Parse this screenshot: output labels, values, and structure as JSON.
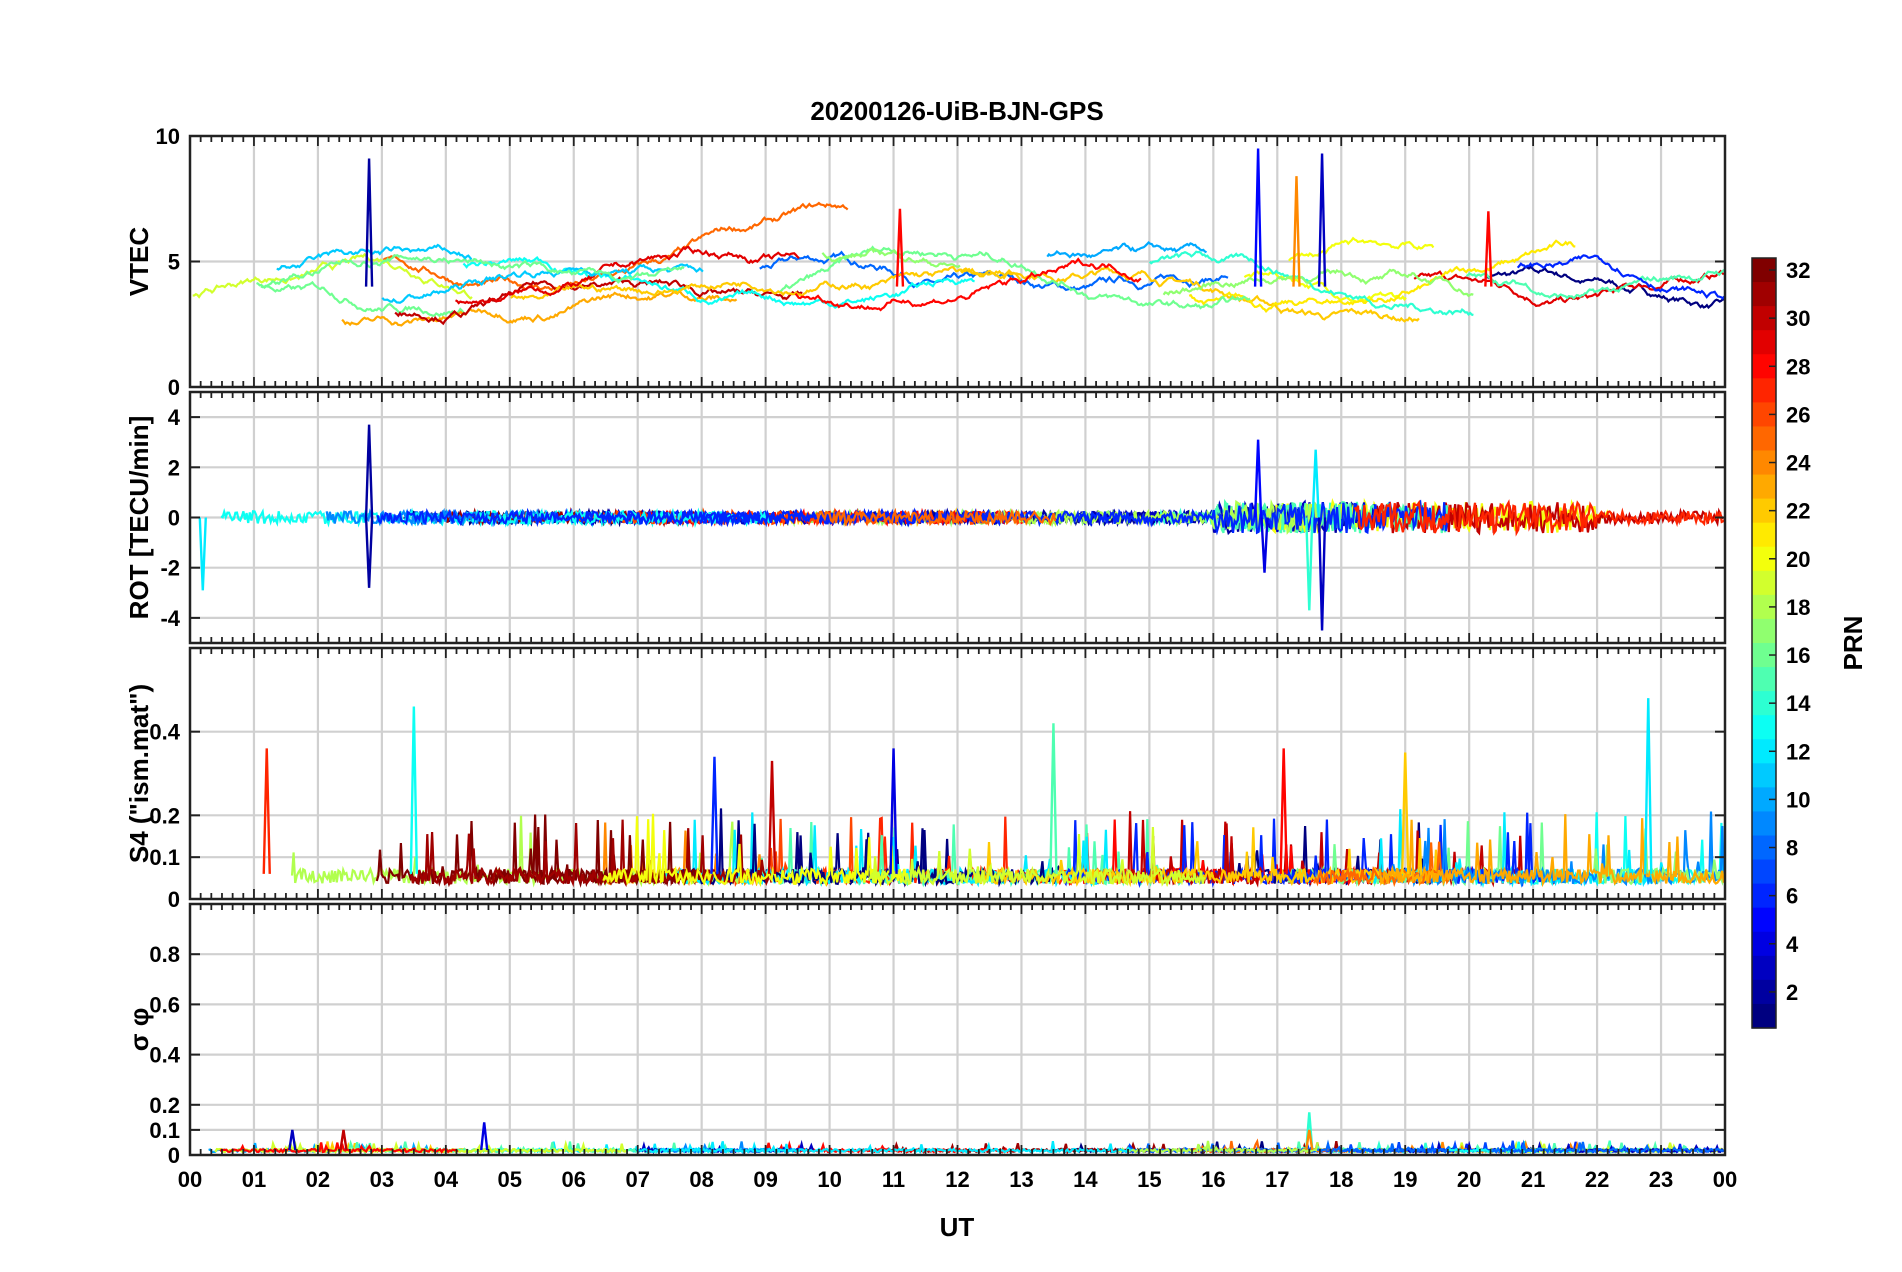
{
  "chart_data": {
    "type": "line",
    "title": "20200126-UiB-BJN-GPS",
    "xlabel": "UT",
    "x_ticks": [
      "00",
      "01",
      "02",
      "03",
      "04",
      "05",
      "06",
      "07",
      "08",
      "09",
      "10",
      "11",
      "12",
      "13",
      "14",
      "15",
      "16",
      "17",
      "18",
      "19",
      "20",
      "21",
      "22",
      "23",
      "00"
    ],
    "xlim_hours": [
      0,
      24
    ],
    "grid": true,
    "colormap": "jet",
    "colorbar": {
      "label": "PRN",
      "range": [
        1,
        32
      ],
      "ticks": [
        2,
        4,
        6,
        8,
        10,
        12,
        14,
        16,
        18,
        20,
        22,
        24,
        26,
        28,
        30,
        32
      ],
      "tick_labels": [
        "2",
        "4",
        "6",
        "8",
        "10",
        "12",
        "14",
        "16",
        "18",
        "20",
        "22",
        "24",
        "26",
        "28",
        "30",
        "32"
      ]
    },
    "panels": [
      {
        "id": "vtec",
        "ylabel": "VTEC",
        "ylim": [
          0,
          10
        ],
        "y_ticks": [
          0,
          5,
          10
        ],
        "y_tick_labels": [
          "0",
          "5",
          "10"
        ],
        "baseline": 4.0,
        "noise": 0.8,
        "spikes": [
          {
            "hour": 2.8,
            "value": 9.1,
            "prn": 2
          },
          {
            "hour": 16.7,
            "value": 9.5,
            "prn": 5
          },
          {
            "hour": 17.7,
            "value": 9.3,
            "prn": 3
          },
          {
            "hour": 17.3,
            "value": 8.4,
            "prn": 24
          },
          {
            "hour": 20.3,
            "value": 7.0,
            "prn": 28
          },
          {
            "hour": 11.1,
            "value": 7.1,
            "prn": 28
          }
        ]
      },
      {
        "id": "rot",
        "ylabel": "ROT [TECU/min]",
        "ylim": [
          -5,
          5
        ],
        "y_ticks": [
          -4,
          -2,
          0,
          2,
          4
        ],
        "y_tick_labels": [
          "-4",
          "-2",
          "0",
          "2",
          "4"
        ],
        "baseline": 0,
        "noise": 0.25,
        "spikes": [
          {
            "hour": 2.8,
            "value": 3.7,
            "prn": 2
          },
          {
            "hour": 2.8,
            "value": -2.8,
            "prn": 2
          },
          {
            "hour": 0.2,
            "value": -2.9,
            "prn": 12
          },
          {
            "hour": 16.7,
            "value": 3.1,
            "prn": 5
          },
          {
            "hour": 16.8,
            "value": -2.2,
            "prn": 4
          },
          {
            "hour": 17.5,
            "value": -3.7,
            "prn": 14
          },
          {
            "hour": 17.7,
            "value": -4.5,
            "prn": 3
          },
          {
            "hour": 17.6,
            "value": 2.7,
            "prn": 12
          }
        ]
      },
      {
        "id": "s4",
        "ylabel": "S4 (\"ism.mat\")",
        "ylim": [
          0,
          0.6
        ],
        "y_ticks": [
          0,
          0.1,
          0.2,
          0.4
        ],
        "y_tick_labels": [
          "0",
          "0.1",
          "0.2",
          "0.4"
        ],
        "baseline": 0.06,
        "noise": 0.05,
        "spikes": [
          {
            "hour": 3.5,
            "value": 0.46,
            "prn": 13
          },
          {
            "hour": 13.5,
            "value": 0.42,
            "prn": 15
          },
          {
            "hour": 22.8,
            "value": 0.48,
            "prn": 12
          },
          {
            "hour": 1.2,
            "value": 0.36,
            "prn": 27
          },
          {
            "hour": 11.0,
            "value": 0.36,
            "prn": 4
          },
          {
            "hour": 17.1,
            "value": 0.36,
            "prn": 28
          },
          {
            "hour": 8.2,
            "value": 0.34,
            "prn": 6
          },
          {
            "hour": 9.1,
            "value": 0.33,
            "prn": 30
          },
          {
            "hour": 19.0,
            "value": 0.35,
            "prn": 22
          }
        ]
      },
      {
        "id": "sigma_phi",
        "ylabel": "σ φ",
        "ylim": [
          0,
          1
        ],
        "y_ticks": [
          0,
          0.1,
          0.2,
          0.4,
          0.6,
          0.8
        ],
        "y_tick_labels": [
          "0",
          "0.1",
          "0.2",
          "0.4",
          "0.6",
          "0.8"
        ],
        "baseline": 0.02,
        "noise": 0.012,
        "spikes": [
          {
            "hour": 4.6,
            "value": 0.13,
            "prn": 4
          },
          {
            "hour": 1.6,
            "value": 0.1,
            "prn": 3
          },
          {
            "hour": 2.4,
            "value": 0.1,
            "prn": 30
          },
          {
            "hour": 17.5,
            "value": 0.17,
            "prn": 14
          },
          {
            "hour": 17.5,
            "value": 0.1,
            "prn": 24
          }
        ]
      }
    ]
  }
}
